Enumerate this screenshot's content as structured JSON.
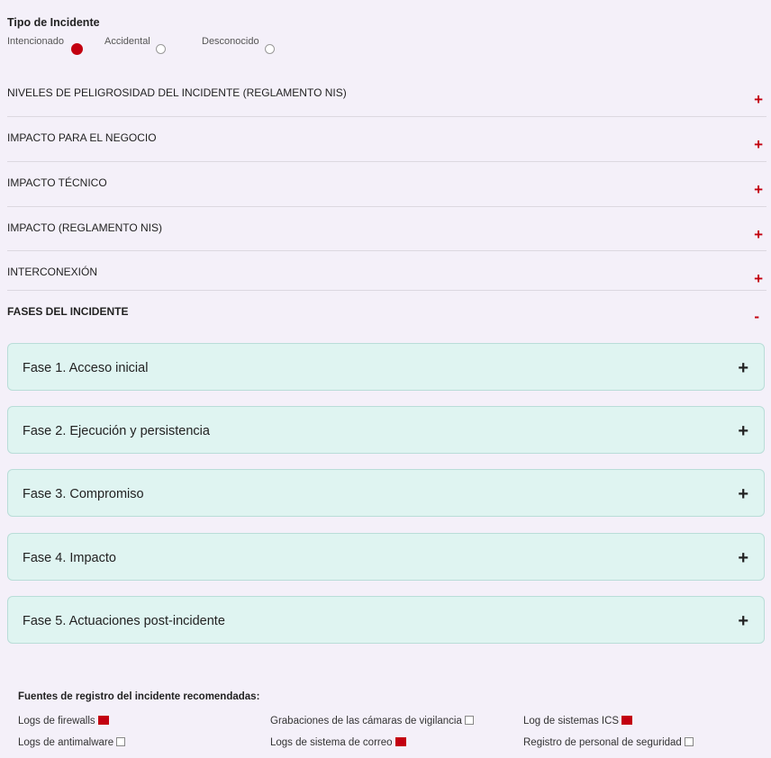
{
  "tipo": {
    "title": "Tipo de Incidente",
    "options": [
      {
        "label": "Intencionado",
        "checked": true
      },
      {
        "label": "Accidental",
        "checked": false
      },
      {
        "label": "Desconocido",
        "checked": false
      }
    ]
  },
  "sections": [
    {
      "label": "NIVELES DE PELIGROSIDAD DEL INCIDENTE (REGLAMENTO NIS)",
      "toggle": "+"
    },
    {
      "label": "IMPACTO PARA EL NEGOCIO",
      "toggle": "+"
    },
    {
      "label": "IMPACTO TÉCNICO",
      "toggle": "+"
    },
    {
      "label": "IMPACTO (REGLAMENTO NIS)",
      "toggle": "+"
    },
    {
      "label": "INTERCONEXIÓN",
      "toggle": "+"
    },
    {
      "label": "FASES DEL INCIDENTE",
      "toggle": "-"
    }
  ],
  "fases": [
    {
      "label": "Fase 1. Acceso inicial",
      "toggle": "+"
    },
    {
      "label": "Fase 2. Ejecución y persistencia",
      "toggle": "+"
    },
    {
      "label": "Fase 3. Compromiso",
      "toggle": "+"
    },
    {
      "label": "Fase 4. Impacto",
      "toggle": "+"
    },
    {
      "label": "Fase 5. Actuaciones post-incidente",
      "toggle": "+"
    }
  ],
  "sources": {
    "title": "Fuentes de registro del incidente recomendadas:",
    "items": [
      {
        "label": "Logs de firewalls",
        "checked": true
      },
      {
        "label": "Grabaciones de las cámaras de vigilancia",
        "checked": false
      },
      {
        "label": "Log de sistemas ICS",
        "checked": true
      },
      {
        "label": "Logs de antimalware",
        "checked": false
      },
      {
        "label": "Logs de sistema de correo",
        "checked": true
      },
      {
        "label": "Registro de personal de seguridad",
        "checked": false
      }
    ]
  },
  "colors": {
    "accent": "#c30010",
    "fase_bg": "#dff4f1",
    "page_bg": "#f4f0f9"
  }
}
